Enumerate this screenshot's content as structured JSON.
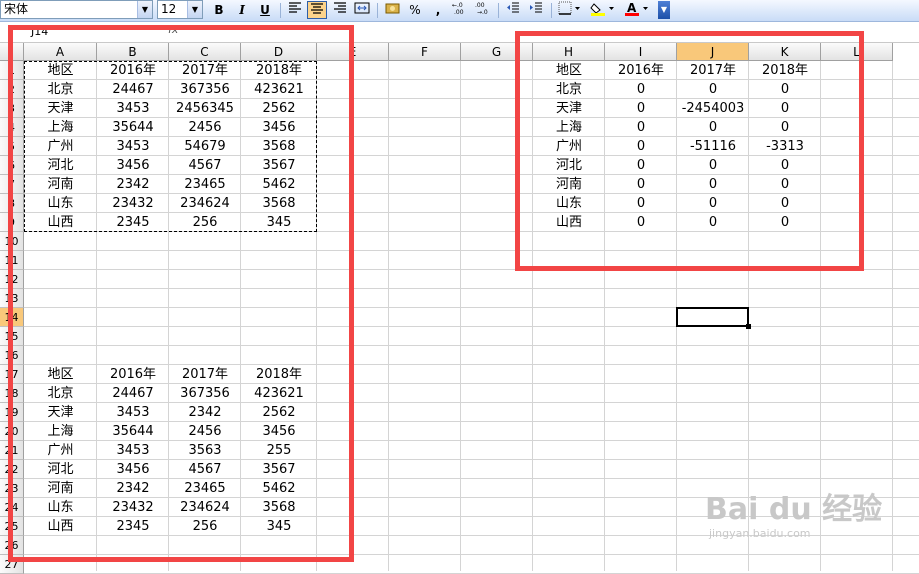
{
  "toolbar": {
    "font_name": "宋体",
    "font_size": "12",
    "bold": "B",
    "italic": "I",
    "underline": "U",
    "percent": "%",
    "comma": ","
  },
  "formula_bar": {
    "name_box": "J14",
    "fx": "fx"
  },
  "columns": [
    "A",
    "B",
    "C",
    "D",
    "E",
    "F",
    "G",
    "H",
    "I",
    "J",
    "K",
    "L"
  ],
  "rows": [
    "1",
    "2",
    "3",
    "4",
    "5",
    "6",
    "7",
    "8",
    "9",
    "10",
    "11",
    "12",
    "13",
    "14",
    "15",
    "16",
    "17",
    "18",
    "19",
    "20",
    "21",
    "22",
    "23",
    "24",
    "25",
    "26",
    "27"
  ],
  "selected": {
    "column": "J",
    "row": "14"
  },
  "table_top": {
    "header": [
      "地区",
      "2016年",
      "2017年",
      "2018年"
    ],
    "rows": [
      [
        "北京",
        "24467",
        "367356",
        "423621"
      ],
      [
        "天津",
        "3453",
        "2456345",
        "2562"
      ],
      [
        "上海",
        "35644",
        "2456",
        "3456"
      ],
      [
        "广州",
        "3453",
        "54679",
        "3568"
      ],
      [
        "河北",
        "3456",
        "4567",
        "3567"
      ],
      [
        "河南",
        "2342",
        "23465",
        "5462"
      ],
      [
        "山东",
        "23432",
        "234624",
        "3568"
      ],
      [
        "山西",
        "2345",
        "256",
        "345"
      ]
    ]
  },
  "table_bottom": {
    "header": [
      "地区",
      "2016年",
      "2017年",
      "2018年"
    ],
    "rows": [
      [
        "北京",
        "24467",
        "367356",
        "423621"
      ],
      [
        "天津",
        "3453",
        "2342",
        "2562"
      ],
      [
        "上海",
        "35644",
        "2456",
        "3456"
      ],
      [
        "广州",
        "3453",
        "3563",
        "255"
      ],
      [
        "河北",
        "3456",
        "4567",
        "3567"
      ],
      [
        "河南",
        "2342",
        "23465",
        "5462"
      ],
      [
        "山东",
        "23432",
        "234624",
        "3568"
      ],
      [
        "山西",
        "2345",
        "256",
        "345"
      ]
    ]
  },
  "table_diff": {
    "header": [
      "地区",
      "2016年",
      "2017年",
      "2018年"
    ],
    "rows": [
      [
        "北京",
        "0",
        "0",
        "0"
      ],
      [
        "天津",
        "0",
        "-2454003",
        "0"
      ],
      [
        "上海",
        "0",
        "0",
        "0"
      ],
      [
        "广州",
        "0",
        "-51116",
        "-3313"
      ],
      [
        "河北",
        "0",
        "0",
        "0"
      ],
      [
        "河南",
        "0",
        "0",
        "0"
      ],
      [
        "山东",
        "0",
        "0",
        "0"
      ],
      [
        "山西",
        "0",
        "0",
        "0"
      ]
    ]
  },
  "watermark": {
    "main": "Bai du 经验",
    "sub": "jingyan.baidu.com"
  },
  "colors": {
    "highlight_box": "#f24545",
    "selection_header": "#f9c87a"
  }
}
